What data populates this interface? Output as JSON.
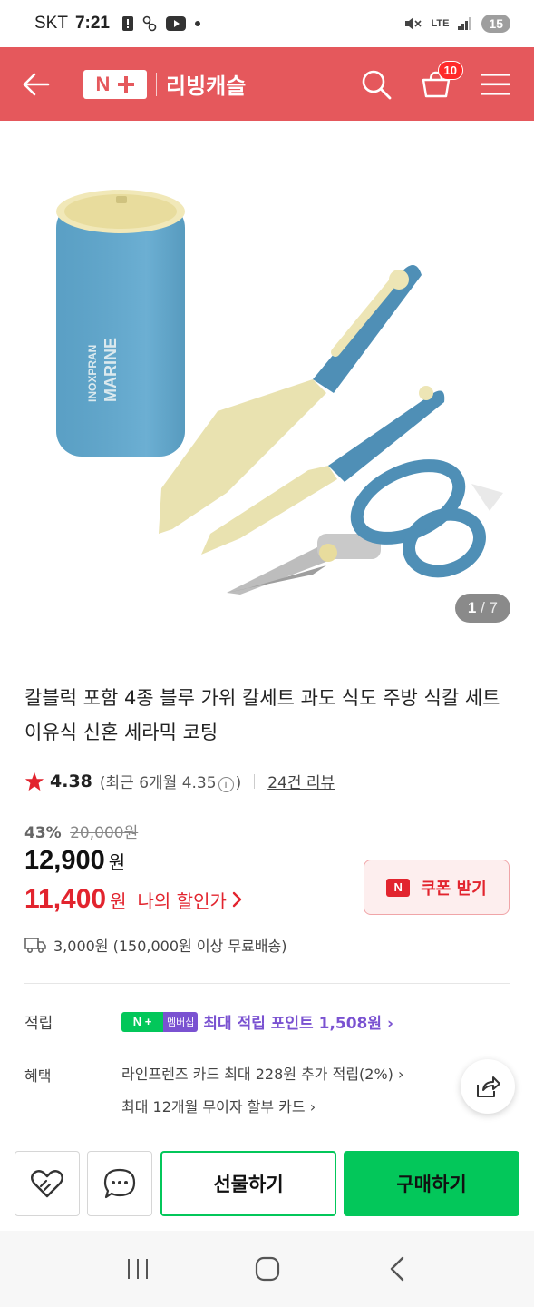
{
  "status_bar": {
    "carrier": "SKT",
    "time": "7:21",
    "network": "LTE",
    "battery": "15"
  },
  "header": {
    "logo_text": "N",
    "store_name": "리빙캐슬",
    "cart_count": "10",
    "bg_color": "#e5585c"
  },
  "product_image": {
    "current_page": "1",
    "total_pages": "7",
    "separator": "/",
    "block_text_1": "INOXPRAN",
    "block_text_2": "MARINE"
  },
  "product": {
    "title": "칼블럭 포함 4종 블루 가위 칼세트 과도 식도 주방 식칼 세트 이유식 신혼 세라믹 코팅",
    "rating": "4.38",
    "recent_rating_prefix": "(최근 6개월 4.35",
    "recent_rating_suffix": ")",
    "reviews": "24건 리뷰"
  },
  "price": {
    "discount_pct": "43%",
    "original": "20,000원",
    "price": "12,900",
    "price_unit": "원",
    "my_price": "11,400",
    "my_price_unit": "원",
    "my_price_label": "나의 할인가",
    "coupon_icon": "N",
    "coupon_label": "쿠폰 받기",
    "accent_color": "#e2242e"
  },
  "shipping": {
    "text": "3,000원 (150,000원 이상 무료배송)"
  },
  "points": {
    "label": "적립",
    "badge_n": "N +",
    "badge_member": "멤버십",
    "text": "최대 적립 포인트 1,508원 ›"
  },
  "benefits": {
    "label": "혜택",
    "line1": "라인프렌즈 카드 최대 228원 추가 적립(2%) ›",
    "line2": "최대 12개월 무이자 할부 카드 ›"
  },
  "actions": {
    "gift_label": "선물하기",
    "buy_label": "구매하기",
    "buy_color": "#03c75a"
  }
}
